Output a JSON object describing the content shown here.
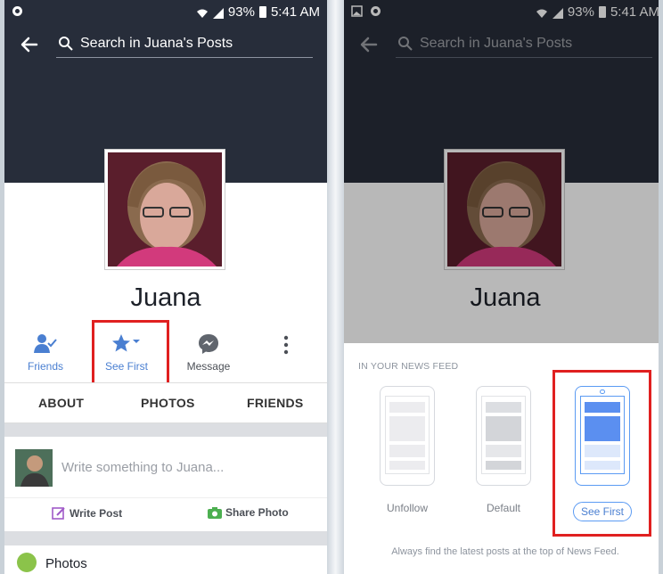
{
  "status": {
    "battery_pct": "93%",
    "time": "5:41 AM"
  },
  "search": {
    "placeholder": "Search in Juana's Posts"
  },
  "profile": {
    "name": "Juana"
  },
  "actions": {
    "friends": "Friends",
    "see_first": "See First",
    "message": "Message"
  },
  "tabs": [
    "ABOUT",
    "PHOTOS",
    "FRIENDS"
  ],
  "composer": {
    "placeholder": "Write something to Juana...",
    "write_post": "Write Post",
    "share_photo": "Share Photo"
  },
  "photos_section": "Photos",
  "news_feed": {
    "header": "IN YOUR NEWS FEED",
    "options": [
      "Unfollow",
      "Default",
      "See First"
    ],
    "selected": "See First",
    "footer": "Always find the latest posts at the top of News Feed."
  },
  "colors": {
    "cover": "#272d3a",
    "fb_blue": "#4a7fd1",
    "highlight": "#e02020",
    "option_blue": "#5b9bf3"
  }
}
